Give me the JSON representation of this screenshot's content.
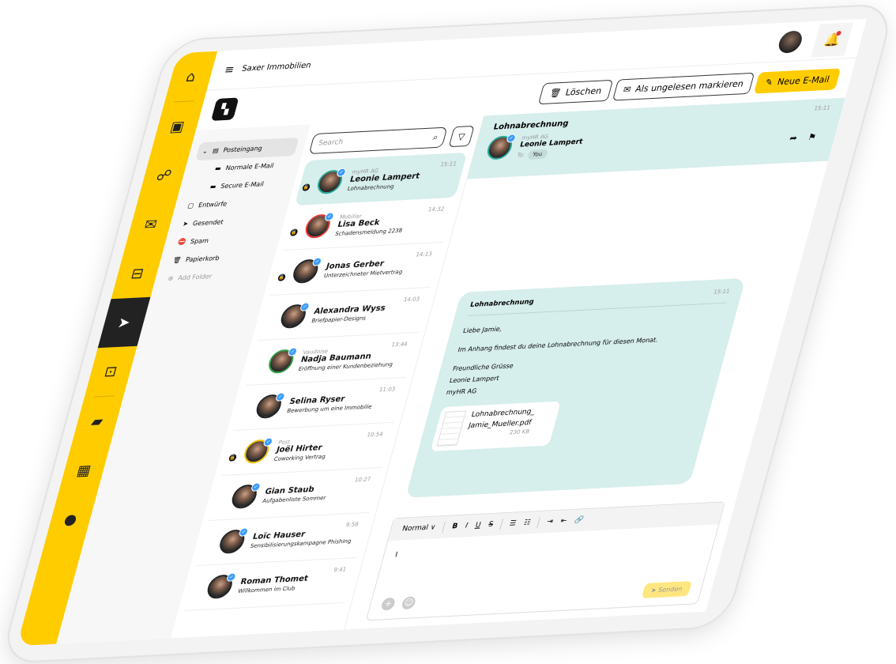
{
  "header": {
    "title": "Saxer Immobilien"
  },
  "toolbar": {
    "delete": "Löschen",
    "mark_unread": "Als ungelesen markieren",
    "new_mail": "Neue E-Mail"
  },
  "nav": [
    "home-icon",
    "desktop-mail-icon",
    "users-icon",
    "mail-icon",
    "mailbox-icon",
    "send-icon",
    "screen-icon",
    "folder-icon",
    "buildings-icon",
    "user-icon"
  ],
  "folders": [
    {
      "label": "Posteingang"
    },
    {
      "label": "Normale E-Mail"
    },
    {
      "label": "Secure E-Mail"
    },
    {
      "label": "Entwürfe"
    },
    {
      "label": "Gesendet"
    },
    {
      "label": "Spam"
    },
    {
      "label": "Papierkorb"
    },
    {
      "label": "Add Folder"
    }
  ],
  "search": {
    "placeholder": "Search"
  },
  "mails": [
    {
      "org": "myHR AG",
      "name": "Leonie Lampert",
      "subject": "Lohnabrechnung",
      "time": "15:11"
    },
    {
      "org": "Mobiliar",
      "name": "Lisa Beck",
      "subject": "Schadensmeldung 2238",
      "time": "14:32"
    },
    {
      "org": "",
      "name": "Jonas Gerber",
      "subject": "Unterzeichneter Mietvertrag",
      "time": "14:13"
    },
    {
      "org": "",
      "name": "Alexandra Wyss",
      "subject": "Briefpapier-Designs",
      "time": "14:03"
    },
    {
      "org": "Vaudoise",
      "name": "Nadja Baumann",
      "subject": "Eröffnung einer Kundenbeziehung",
      "time": "13:44"
    },
    {
      "org": "",
      "name": "Selina Ryser",
      "subject": "Bewerbung um eine Immobilie",
      "time": "11:03"
    },
    {
      "org": "Post",
      "name": "Joël Hirter",
      "subject": "Coworking Vertrag",
      "time": "10:54"
    },
    {
      "org": "",
      "name": "Gian Staub",
      "subject": "Aufgabenliste Sommer",
      "time": "10:27"
    },
    {
      "org": "",
      "name": "Loïc Hauser",
      "subject": "Sensibilisierungskampagne Phishing",
      "time": "9:58"
    },
    {
      "org": "",
      "name": "Roman Thomet",
      "subject": "Willkommen im Club",
      "time": "9:41"
    }
  ],
  "reading": {
    "subject": "Lohnabrechnung",
    "time": "15:11",
    "org": "myHR AG",
    "sender": "Leonie Lampert",
    "to_label": "To:",
    "to": "You",
    "body_subject": "Lohnabrechnung",
    "body_time": "15:11",
    "greeting": "Liebe Jamie,",
    "text": "Im Anhang findest du deine Lohnabrechnung für diesen Monat.",
    "closing": "Freundliche Grüsse",
    "sig_name": "Leonie Lampert",
    "sig_org": "myHR AG",
    "attachment": {
      "name1": "Lohnabrechnung_",
      "name2": "Jamie_Mueller.pdf",
      "size": "230 KB"
    }
  },
  "composer": {
    "format": "Normal",
    "cursor": "I",
    "send": "Senden"
  },
  "colors": {
    "accent": "#ffcc00",
    "selected": "#d6eeec",
    "dark": "#222222"
  }
}
